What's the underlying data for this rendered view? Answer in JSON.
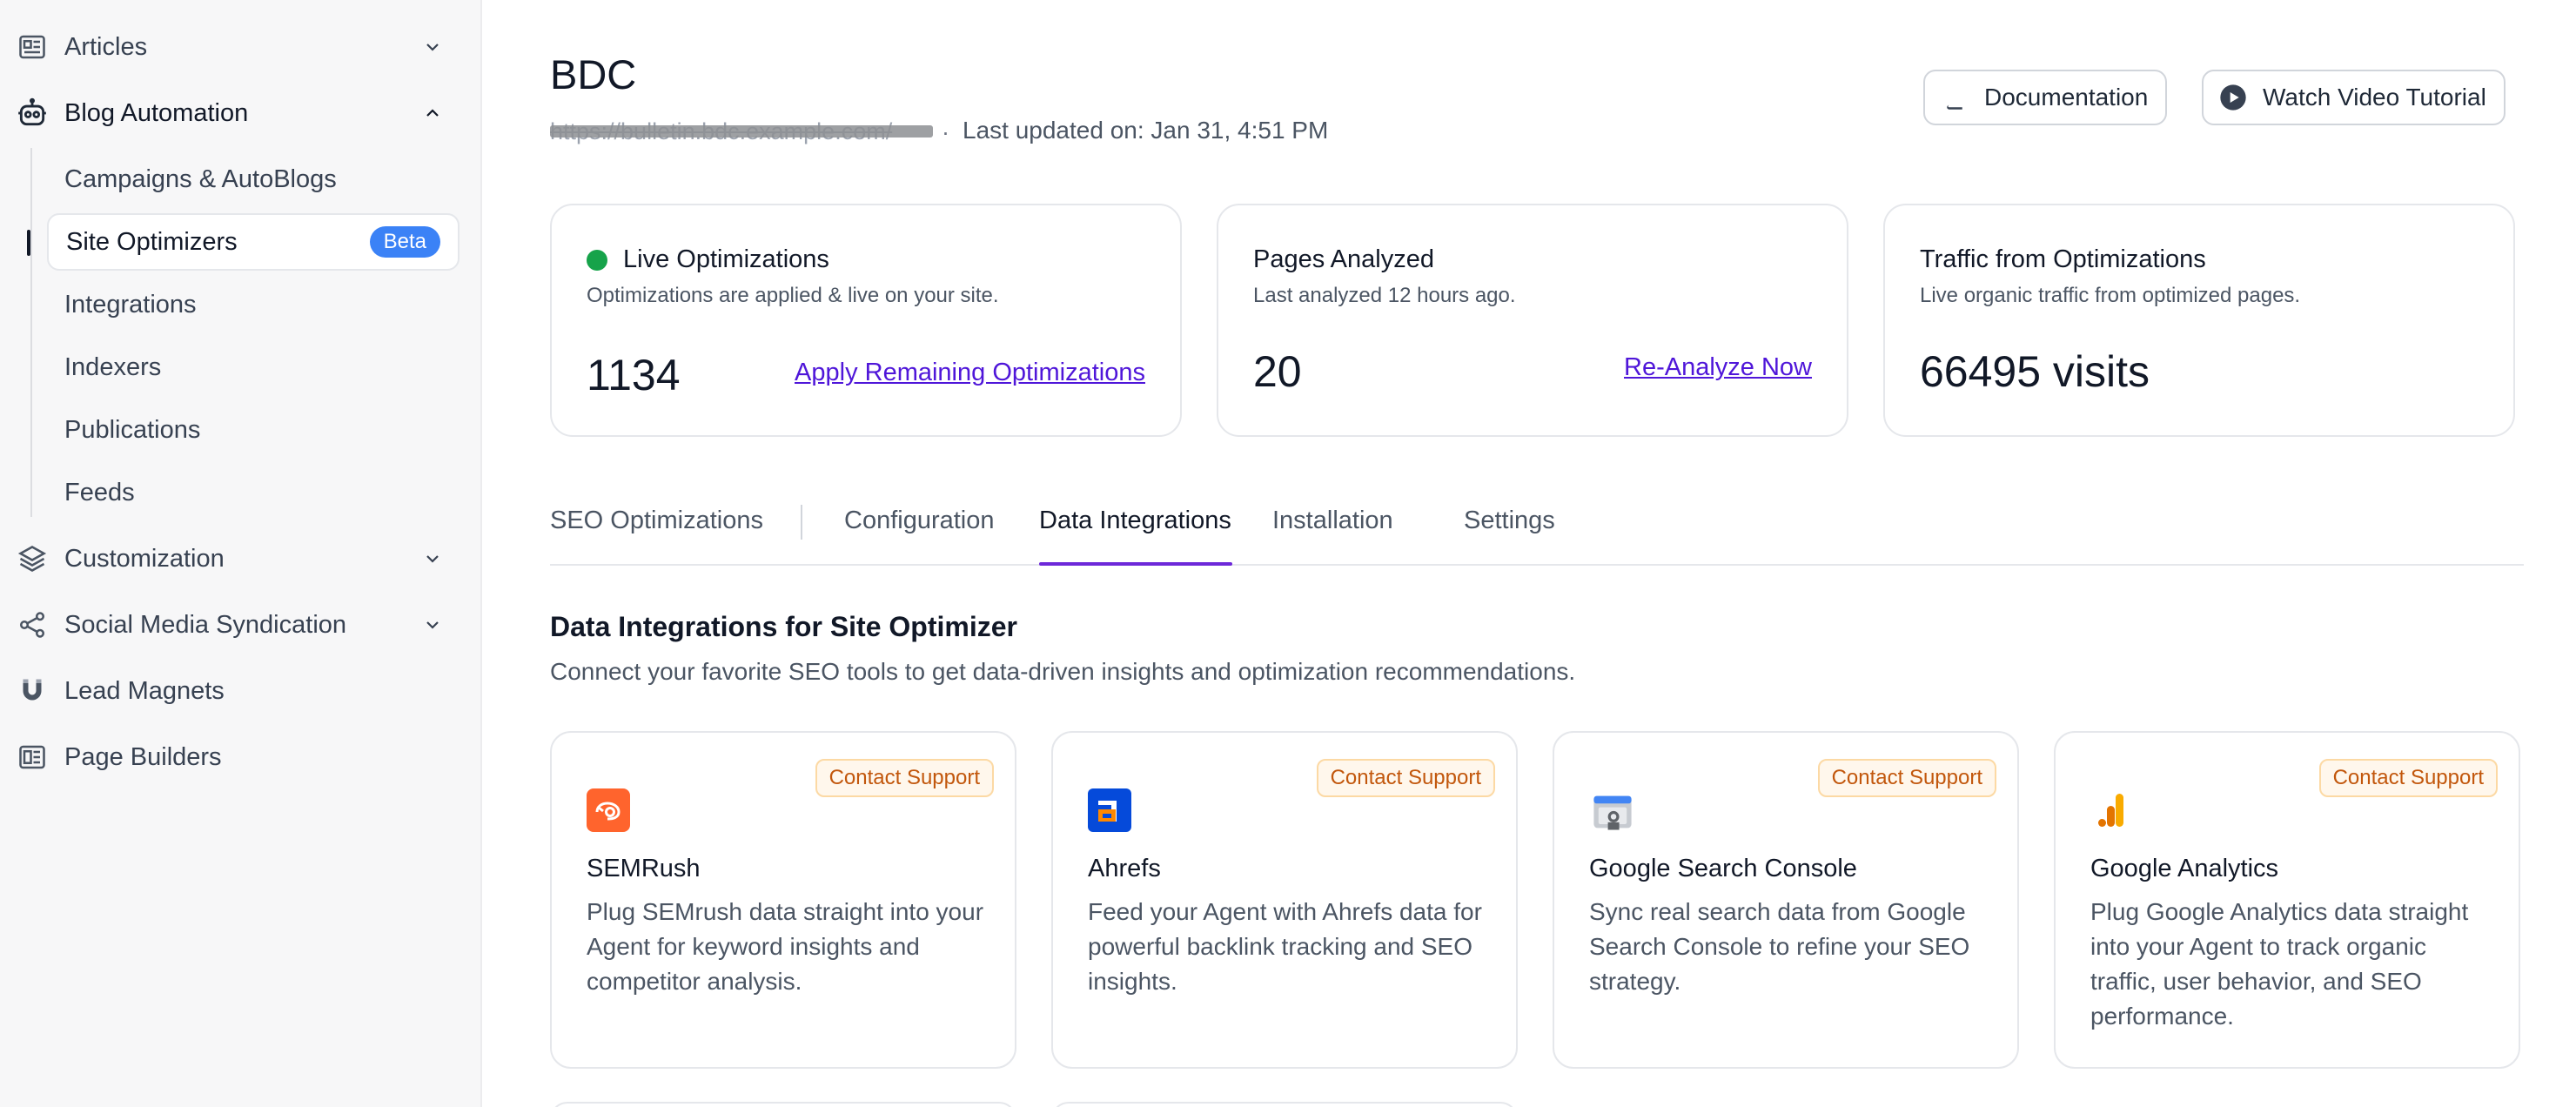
{
  "sidebar": {
    "items": [
      {
        "label": "Articles",
        "icon": "articles-icon",
        "chevron": "down"
      },
      {
        "label": "Blog Automation",
        "icon": "robot-icon",
        "chevron": "up"
      },
      {
        "label": "Customization",
        "icon": "layers-icon",
        "chevron": "down"
      },
      {
        "label": "Social Media Syndication",
        "icon": "share-icon",
        "chevron": "down"
      },
      {
        "label": "Lead Magnets",
        "icon": "magnet-icon"
      },
      {
        "label": "Page Builders",
        "icon": "page-builder-icon"
      }
    ],
    "sub_items": [
      {
        "label": "Campaigns & AutoBlogs"
      },
      {
        "label": "Site Optimizers",
        "badge": "Beta",
        "active": true
      },
      {
        "label": "Integrations"
      },
      {
        "label": "Indexers"
      },
      {
        "label": "Publications"
      },
      {
        "label": "Feeds"
      }
    ]
  },
  "header": {
    "title": "BDC",
    "url": "https://bulletin.bdc.example.com/",
    "updated": "Last updated on: Jan 31, 4:51 PM",
    "buttons": {
      "documentation": "Documentation",
      "video": "Watch Video Tutorial"
    }
  },
  "stats": [
    {
      "title": "Live Optimizations",
      "subtitle": "Optimizations are applied & live on your site.",
      "value": "1134",
      "link": "Apply Remaining Optimizations"
    },
    {
      "title": "Pages Analyzed",
      "subtitle": "Last analyzed 12 hours ago.",
      "value": "20",
      "link": "Re-Analyze Now"
    },
    {
      "title": "Traffic from Optimizations",
      "subtitle": "Live organic traffic from optimized pages.",
      "value": "66495 visits"
    }
  ],
  "tabs": [
    "SEO Optimizations",
    "Configuration",
    "Data Integrations",
    "Installation",
    "Settings"
  ],
  "active_tab": "Data Integrations",
  "section": {
    "title": "Data Integrations for Site Optimizer",
    "subtitle": "Connect your favorite SEO tools to get data-driven insights and optimization recommendations."
  },
  "integrations": [
    {
      "name": "SEMRush",
      "badge": "Contact Support",
      "description": "Plug SEMrush data straight into your Agent for keyword insights and competitor analysis.",
      "icon": "semrush-logo-icon"
    },
    {
      "name": "Ahrefs",
      "badge": "Contact Support",
      "description": "Feed your Agent with Ahrefs data for powerful backlink tracking and SEO insights.",
      "icon": "ahrefs-logo-icon"
    },
    {
      "name": "Google Search Console",
      "badge": "Contact Support",
      "description": "Sync real search data from Google Search Console to refine your SEO strategy.",
      "icon": "google-search-console-logo-icon"
    },
    {
      "name": "Google Analytics",
      "badge": "Contact Support",
      "description": "Plug Google Analytics data straight into your Agent to track organic traffic, user behavior, and SEO performance.",
      "icon": "google-analytics-logo-icon"
    }
  ],
  "colors": {
    "accent": "#6d28d9",
    "link": "#4f16d9",
    "beta": "#3b82f6",
    "live": "#16a34a",
    "badge_text": "#c2570c",
    "semrush": "#ff642d",
    "ahrefs": "#054ada",
    "analytics": "#f9ab00"
  }
}
